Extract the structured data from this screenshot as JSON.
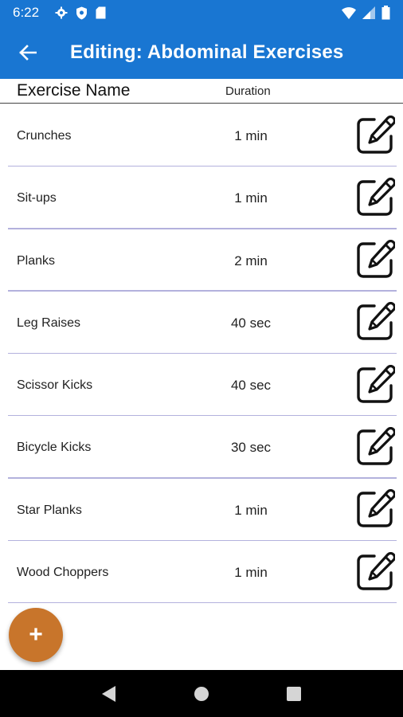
{
  "status_bar": {
    "time": "6:22",
    "left_icons": [
      "gear-icon",
      "shield-icon",
      "sd-card-icon"
    ],
    "right_icons": [
      "wifi-icon",
      "signal-icon",
      "battery-icon"
    ]
  },
  "app_bar": {
    "title": "Editing: Abdominal Exercises",
    "back_icon": "arrow-back-icon",
    "color": "#1976d2"
  },
  "table": {
    "headers": {
      "name": "Exercise Name",
      "duration": "Duration"
    },
    "rows": [
      {
        "name": "Crunches",
        "duration": "1 min"
      },
      {
        "name": "Sit-ups",
        "duration": "1 min"
      },
      {
        "name": "Planks",
        "duration": "2 min"
      },
      {
        "name": "Leg Raises",
        "duration": "40 sec"
      },
      {
        "name": "Scissor Kicks",
        "duration": "40 sec"
      },
      {
        "name": "Bicycle Kicks",
        "duration": "30 sec"
      },
      {
        "name": "Star Planks",
        "duration": "1 min"
      },
      {
        "name": "Wood Choppers",
        "duration": "1 min"
      }
    ]
  },
  "fab": {
    "label": "+",
    "color": "#c8752b"
  },
  "nav_bar": {
    "icons": [
      "back-triangle-icon",
      "home-circle-icon",
      "recents-square-icon"
    ]
  }
}
